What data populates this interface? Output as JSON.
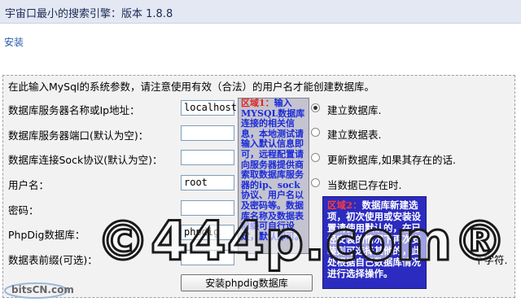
{
  "window": {
    "title": "宇宙口最小的搜索引擎：版本 1.8.8"
  },
  "nav": {
    "install_link": "安装"
  },
  "form": {
    "intro": "在此输入MySql的系统参数，请注意使用有效（合法）的用户名才能创建数据库。",
    "fields": [
      {
        "label": "数据库服务器名称或Ip地址：",
        "value": "localhost"
      },
      {
        "label": "数据库服务器端口(默认为空)：",
        "value": ""
      },
      {
        "label": "数据库连接Sock协议(默认为空)：",
        "value": ""
      },
      {
        "label": "用户名：",
        "value": "root"
      },
      {
        "label": "密码：",
        "value": ""
      },
      {
        "label": "PhpDig数据库：",
        "value": "phpdig"
      },
      {
        "label": "数据表前缀(可选)：",
        "value": ""
      }
    ],
    "options": [
      {
        "label": "建立数据库.",
        "selected": true
      },
      {
        "label": "建立数据表.",
        "selected": false
      },
      {
        "label": "更新数据库,如果其存在的话.",
        "selected": false
      },
      {
        "label": "当数据已存在时.",
        "selected": false
      },
      {
        "label": "个字符.",
        "selected": false
      }
    ],
    "submit_label": "安装phpdig数据库"
  },
  "annotations": {
    "area1": {
      "title": "区域1：",
      "text": "输入MYSQL数据库连接的相关信息，本地测试请输入默认信息即可，远程配置请向服务器提供商索取数据库服务器的ip、sock协议、用户名以及密码等。数据库名称及数据表前缀可自行设定，默认即可。"
    },
    "area2": {
      "title": "区域2：",
      "text": "数据库新建选项，初次使用或安装设置请使用默认的，在已经安装的情况下再次安装则可选择其他的，此处根据自己数据库情况进行选择操作。"
    }
  },
  "watermark": {
    "text": "©444p.com®",
    "logo": "bitsCN.com"
  }
}
